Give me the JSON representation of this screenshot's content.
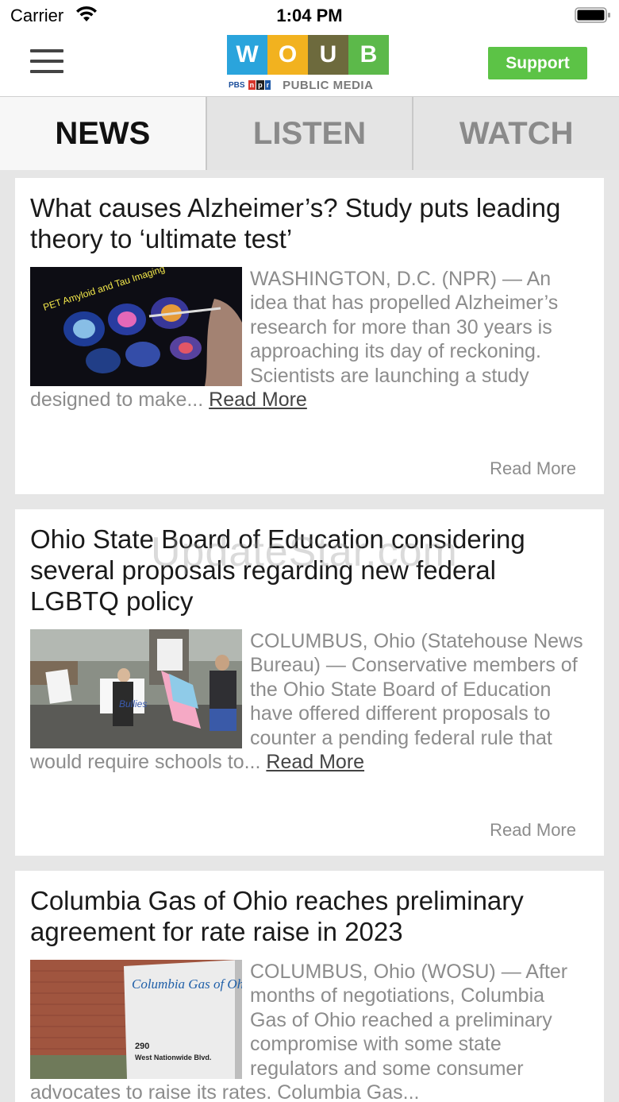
{
  "status_bar": {
    "carrier": "Carrier",
    "time": "1:04 PM"
  },
  "header": {
    "logo": {
      "letters": [
        "W",
        "O",
        "U",
        "B"
      ],
      "tile_colors": [
        "#2aa4dc",
        "#f2b21f",
        "#6d6a3d",
        "#5cb94a"
      ],
      "pbs": "PBS",
      "npr": [
        "n",
        "p",
        "r"
      ],
      "npr_colors": [
        "#d6362b",
        "#222",
        "#1e5aa8"
      ],
      "subtitle": "PUBLIC MEDIA"
    },
    "support_label": "Support",
    "menu_icon": "hamburger-menu-icon"
  },
  "tabs": [
    {
      "label": "NEWS",
      "active": true
    },
    {
      "label": "LISTEN",
      "active": false
    },
    {
      "label": "WATCH",
      "active": false
    }
  ],
  "articles": [
    {
      "title": "What causes Alzheimer’s? Study puts leading theory to ‘ultimate test’",
      "excerpt": "WASHINGTON, D.C. (NPR) — An idea that has propelled Alzheimer’s research for more than 30 years is approaching its day of reckoning. Scientists are launching a study designed to make...",
      "inline_read_more": "Read More",
      "read_more": "Read More",
      "image_text": "PET Amyloid and Tau Imaging"
    },
    {
      "title": "Ohio State Board of Education considering several proposals regarding new federal LGBTQ policy",
      "excerpt": "COLUMBUS, Ohio (Statehouse News Bureau) — Conservative members of the Ohio State Board of Education have offered different proposals to counter a pending federal rule that would require schools to...",
      "inline_read_more": "Read More",
      "read_more": "Read More",
      "image_text": "Bullies"
    },
    {
      "title": "Columbia Gas of Ohio reaches preliminary agreement for rate raise in 2023",
      "excerpt": "COLUMBUS, Ohio (WOSU) — After months of negotiations, Columbia Gas of Ohio reached a preliminary compromise with some state regulators and some consumer advocates to raise its rates. Columbia Gas...",
      "inline_read_more": "",
      "read_more": "",
      "image_text": "Columbia Gas of Ohio"
    }
  ],
  "watermark": "UpdateStar.com"
}
